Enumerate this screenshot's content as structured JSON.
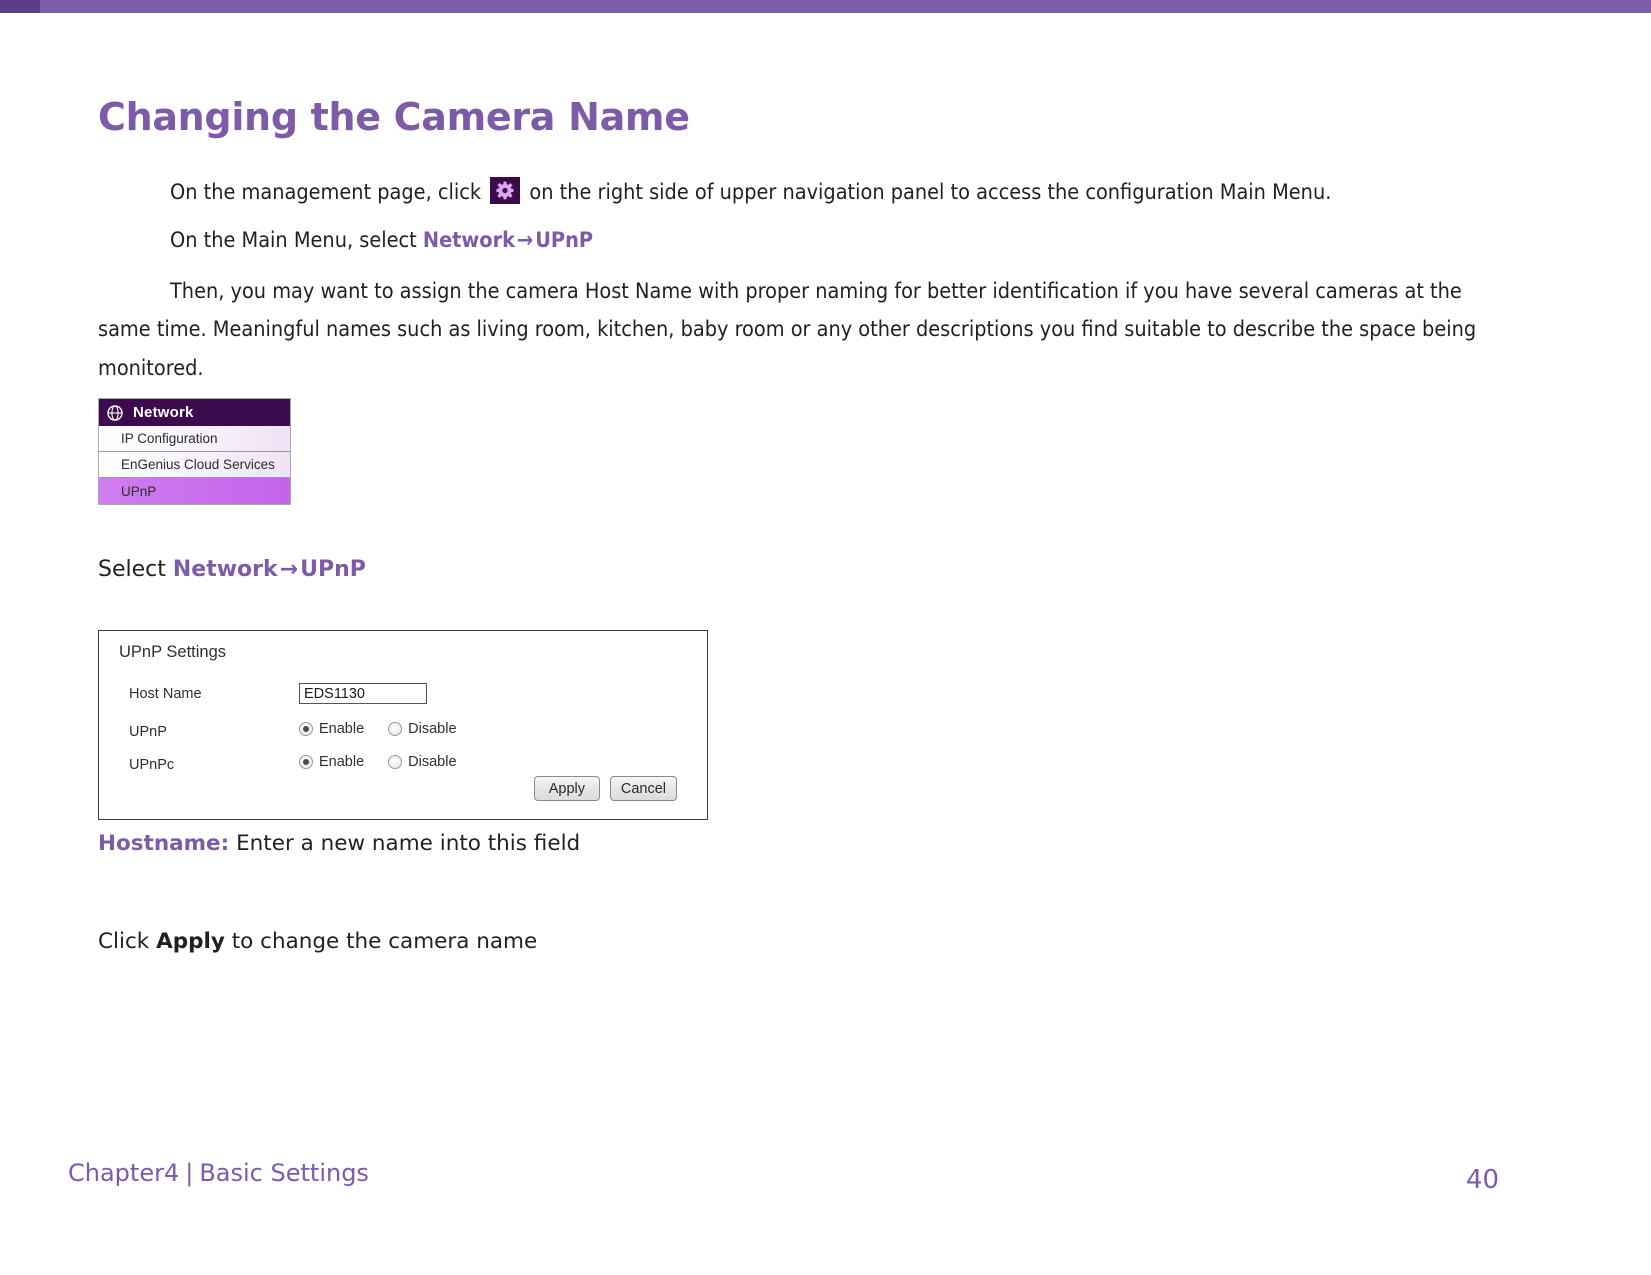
{
  "document": {
    "title": "Changing the Camera Name",
    "accent_color": "#7d5ba6",
    "header_bar_color": "#7b5ea7"
  },
  "steps": {
    "step1_before_icon": "On the management page, click",
    "step1_icon": "gear-icon",
    "step1_after_icon": "on the right side of upper navigation panel  to access the configuration Main Menu.",
    "step2_prefix": "On the Main Menu, select",
    "step2_link1": "Network",
    "step2_arrow": "→",
    "step2_link2": "UPnP"
  },
  "paragraph": {
    "text": "Then, you may want to assign the camera Host Name with proper naming for better identification if you have several cameras at the same time. Meaningful names such as living room, kitchen, baby room or any other descriptions you find suitable to describe the space being monitored."
  },
  "network_menu": {
    "header_icon": "globe-icon",
    "header_label": "Network",
    "items": [
      {
        "label": "IP Configuration",
        "selected": false
      },
      {
        "label": "EnGenius Cloud Services",
        "selected": false
      },
      {
        "label": "UPnP",
        "selected": true
      }
    ],
    "header_bg": "#3b0b4d",
    "selected_bg": "#c96ded"
  },
  "select_line": {
    "prefix": "Select",
    "link1": "Network",
    "arrow": "→",
    "link2": "UPnP"
  },
  "upnp_panel": {
    "title": "UPnP Settings",
    "host_name": {
      "label": "Host Name",
      "value": "EDS1130"
    },
    "upnp": {
      "label": "UPnP",
      "enable_label": "Enable",
      "disable_label": "Disable",
      "selected": "Enable"
    },
    "upnpc": {
      "label": "UPnPc",
      "enable_label": "Enable",
      "disable_label": "Disable",
      "selected": "Enable"
    },
    "apply_label": "Apply",
    "cancel_label": "Cancel"
  },
  "captions": {
    "hostname_term": "Hostname:",
    "hostname_desc": "Enter a new name into this field",
    "apply_prefix": "Click",
    "apply_bold": "Apply",
    "apply_suffix": "to change the camera name"
  },
  "footer": {
    "chapter": "Chapter4",
    "separator": "|",
    "section": "Basic Settings",
    "page_number": "40"
  }
}
